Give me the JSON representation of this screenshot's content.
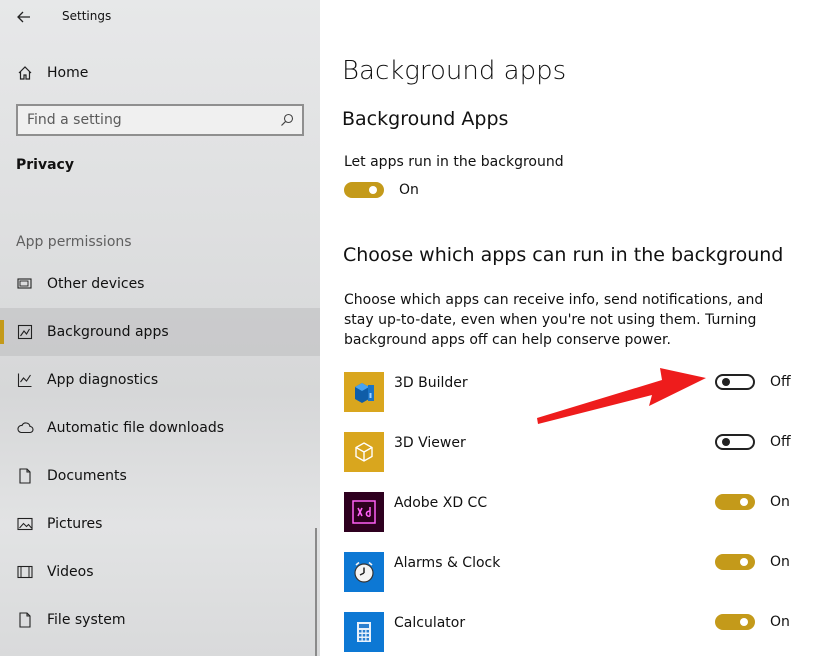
{
  "window": {
    "title": "Settings"
  },
  "sidebar": {
    "home_label": "Home",
    "search_placeholder": "Find a setting",
    "section_title": "Privacy",
    "group_title": "App permissions",
    "items": [
      {
        "label": "Other devices",
        "icon": "device-icon",
        "selected": false
      },
      {
        "label": "Background apps",
        "icon": "background-apps-icon",
        "selected": true
      },
      {
        "label": "App diagnostics",
        "icon": "diagnostics-icon",
        "selected": false
      },
      {
        "label": "Automatic file downloads",
        "icon": "cloud-icon",
        "selected": false
      },
      {
        "label": "Documents",
        "icon": "document-icon",
        "selected": false
      },
      {
        "label": "Pictures",
        "icon": "picture-icon",
        "selected": false
      },
      {
        "label": "Videos",
        "icon": "video-icon",
        "selected": false
      },
      {
        "label": "File system",
        "icon": "file-icon",
        "selected": false
      }
    ]
  },
  "main": {
    "page_title": "Background apps",
    "section1_title": "Background Apps",
    "let_apps_label": "Let apps run in the background",
    "let_apps_toggle": {
      "state": "On",
      "on": true
    },
    "section2_title": "Choose which apps can run in the background",
    "description": "Choose which apps can receive info, send notifications, and stay up-to-date, even when you're not using them. Turning background apps off can help conserve power.",
    "apps": [
      {
        "name": "3D Builder",
        "state": "Off",
        "on": false,
        "icon": "3d-builder-icon",
        "icon_bg": "#d9a61e"
      },
      {
        "name": "3D Viewer",
        "state": "Off",
        "on": false,
        "icon": "3d-viewer-icon",
        "icon_bg": "#d9a61e"
      },
      {
        "name": "Adobe XD CC",
        "state": "On",
        "on": true,
        "icon": "adobe-xd-icon",
        "icon_bg": "#2e001f"
      },
      {
        "name": "Alarms & Clock",
        "state": "On",
        "on": true,
        "icon": "alarm-clock-icon",
        "icon_bg": "#0d78d4"
      },
      {
        "name": "Calculator",
        "state": "On",
        "on": true,
        "icon": "calculator-icon",
        "icon_bg": "#0d78d4"
      }
    ]
  },
  "colors": {
    "accent": "#c49a1a",
    "sidebar_bg": "#dedfe0",
    "annotation_arrow": "#ee1c1c"
  }
}
